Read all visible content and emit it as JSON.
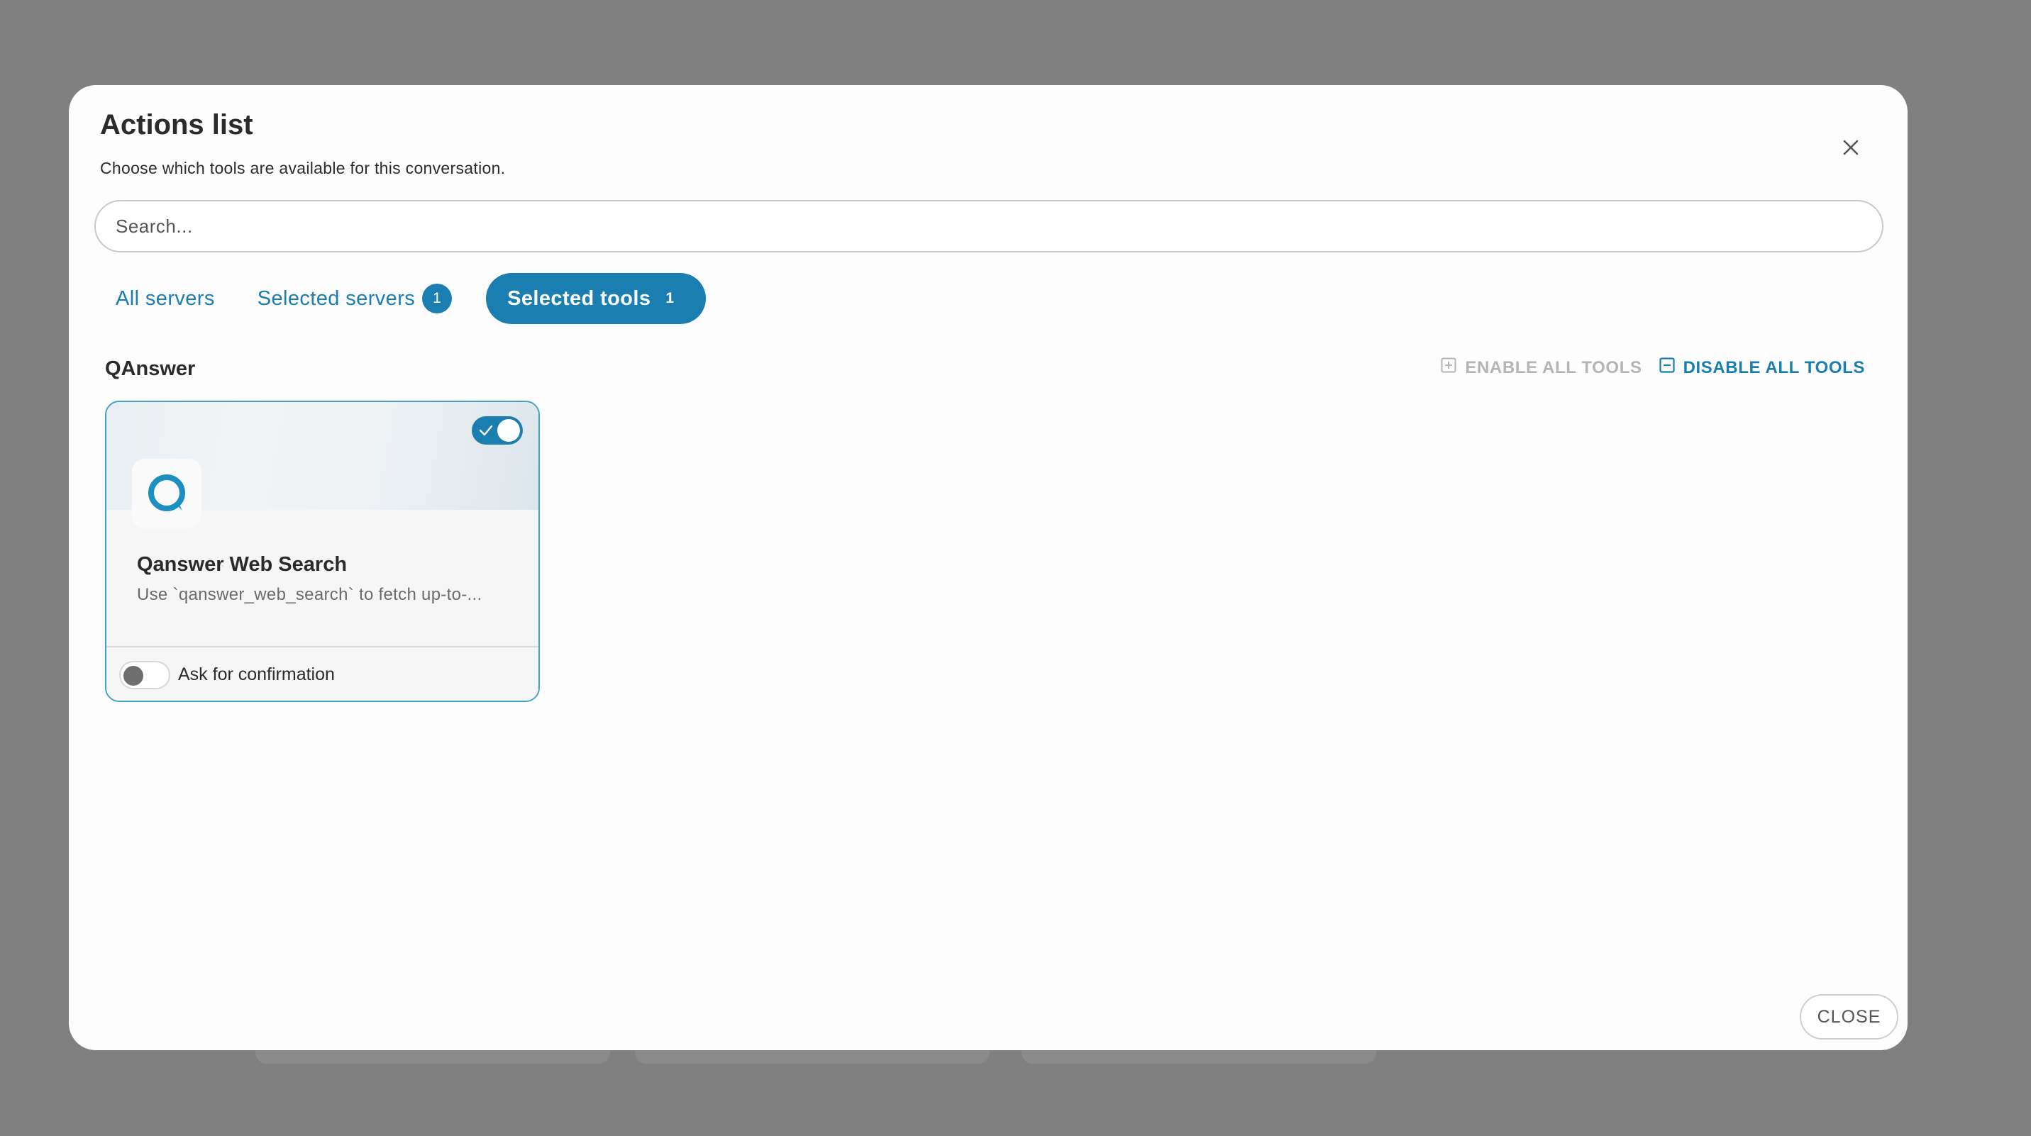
{
  "modal": {
    "title": "Actions list",
    "subtitle": "Choose which tools are available for this conversation."
  },
  "search": {
    "placeholder": "Search..."
  },
  "tabs": [
    {
      "label": "All servers",
      "active": false,
      "count": null
    },
    {
      "label": "Selected servers",
      "active": false,
      "count": "1"
    },
    {
      "label": "Selected tools",
      "active": true,
      "count": "1"
    }
  ],
  "section": {
    "title": "QAnswer",
    "enable_all_label": "ENABLE ALL TOOLS",
    "disable_all_label": "DISABLE ALL TOOLS",
    "enable_all_disabled": true
  },
  "tool_card": {
    "name": "Qanswer Web Search",
    "description": "Use `qanswer_web_search` to fetch up-to-...",
    "enabled": true,
    "ask_confirmation_label": "Ask for confirmation",
    "ask_confirmation": false,
    "logo_icon": "qanswer-logo-icon"
  },
  "footer": {
    "close_label": "CLOSE"
  },
  "colors": {
    "accent": "#1a7fb0",
    "overlay": "#808080",
    "disabled_text": "#b5b5b5"
  }
}
